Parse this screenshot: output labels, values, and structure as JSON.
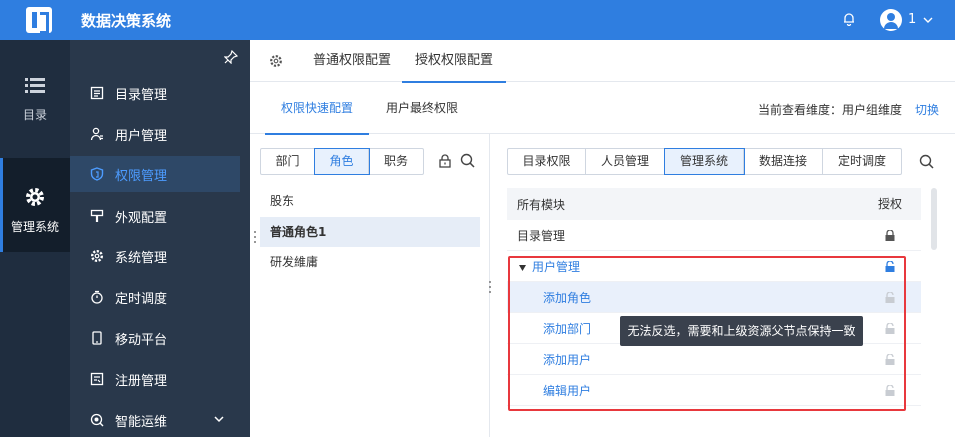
{
  "app": {
    "title": "数据决策系统",
    "user_name": "1"
  },
  "rail": {
    "items": [
      {
        "label": "目录",
        "icon": "list-icon"
      },
      {
        "label": "管理系统",
        "icon": "gear-icon"
      }
    ]
  },
  "sidebar": {
    "items": [
      {
        "label": "目录管理",
        "icon": "catalog-icon"
      },
      {
        "label": "用户管理",
        "icon": "user-icon"
      },
      {
        "label": "权限管理",
        "icon": "shield-icon"
      },
      {
        "label": "外观配置",
        "icon": "paint-icon"
      },
      {
        "label": "系统管理",
        "icon": "gear-icon"
      },
      {
        "label": "定时调度",
        "icon": "timer-icon"
      },
      {
        "label": "移动平台",
        "icon": "mobile-icon"
      },
      {
        "label": "注册管理",
        "icon": "register-icon"
      },
      {
        "label": "智能运维",
        "icon": "ops-icon"
      }
    ]
  },
  "main_tabs": [
    "普通权限配置",
    "授权权限配置"
  ],
  "sub_tabs": [
    "权限快速配置",
    "用户最终权限"
  ],
  "dimension": {
    "label": "当前查看维度：用户组维度",
    "switch": "切换"
  },
  "left_pane": {
    "seg_buttons": [
      "部门",
      "角色",
      "职务"
    ],
    "roles": [
      "股东",
      "普通角色1",
      "研发維庸"
    ]
  },
  "right_pane": {
    "cat_tabs": [
      "目录权限",
      "人员管理",
      "管理系统",
      "数据连接",
      "定时调度"
    ],
    "headers": {
      "module": "所有模块",
      "auth": "授权"
    },
    "rows": [
      "目录管理",
      "用户管理",
      "添加角色",
      "添加部门",
      "添加用户",
      "编辑用户"
    ]
  },
  "tooltip": "无法反选，需要和上级资源父节点保持一致",
  "colors": {
    "primary": "#2f7ee0",
    "sidebar_bg": "#29384b",
    "rail_bg": "#1f2d3f",
    "highlight": "#e8383d"
  }
}
